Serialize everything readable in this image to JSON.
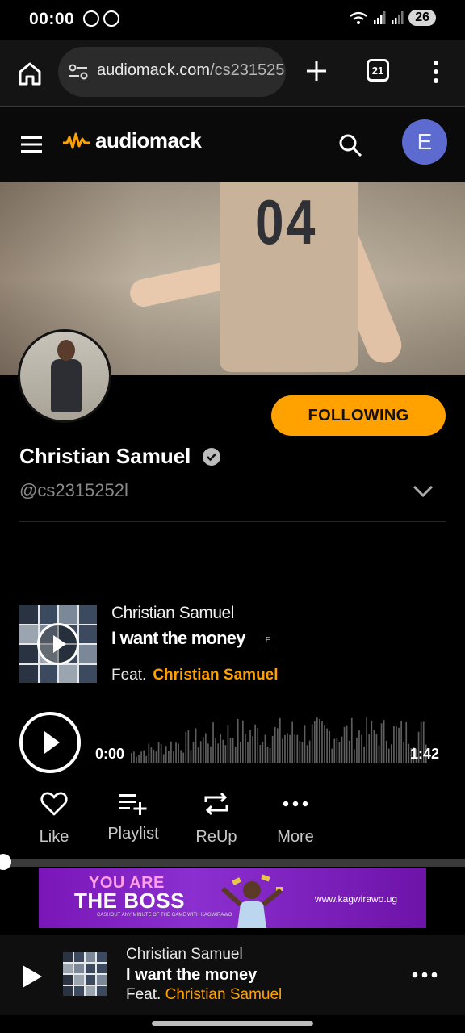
{
  "status_bar": {
    "time": "00:00",
    "battery": "26"
  },
  "browser": {
    "url_host": "audiomack.com",
    "url_path": "/cs231525",
    "tab_count": "21"
  },
  "app": {
    "logo_text": "audiomack",
    "account_initial": "E"
  },
  "banner": {
    "jersey_number": "04"
  },
  "profile": {
    "name": "Christian Samuel",
    "handle": "@cs2315252l",
    "follow_label": "FOLLOWING"
  },
  "track": {
    "artist": "Christian Samuel",
    "title": "I want the money",
    "explicit_label": "E",
    "feat_label": "Feat.",
    "feat_artist": "Christian Samuel",
    "time_elapsed": "0:00",
    "duration": "1:42",
    "progress": 0
  },
  "actions": [
    {
      "label": "Like",
      "icon": "heart-icon"
    },
    {
      "label": "Playlist",
      "icon": "add-to-playlist-icon"
    },
    {
      "label": "ReUp",
      "icon": "repost-icon"
    },
    {
      "label": "More",
      "icon": "more-dots-icon"
    }
  ],
  "ad": {
    "line1": "YOU ARE",
    "line2": "THE BOSS",
    "fine_print": "CASHOUT ANY MINUTE OF THE GAME WITH KAGWIRAWO",
    "url": "www.kagwirawo.ug"
  },
  "mini_player": {
    "artist": "Christian Samuel",
    "title": "I want the money",
    "feat_label": "Feat.",
    "feat_artist": "Christian Samuel"
  },
  "colors": {
    "accent": "#ffa200",
    "avatar_bg": "#5d6bd0",
    "background": "#0a0a0a"
  }
}
